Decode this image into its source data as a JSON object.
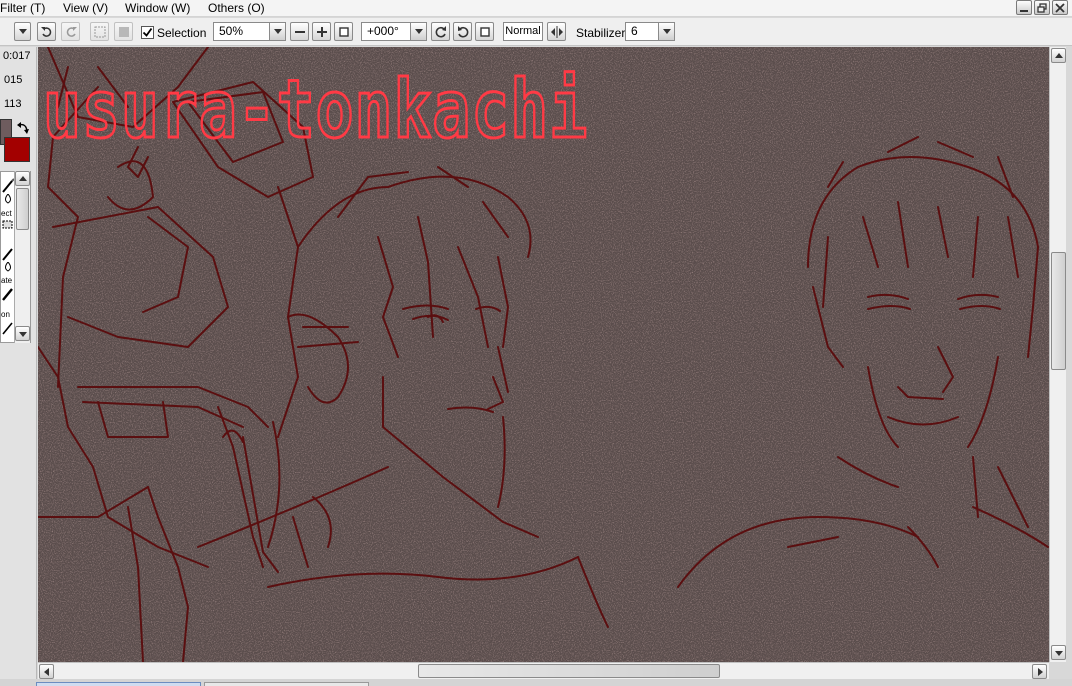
{
  "menubar": {
    "items": [
      "Filter (T)",
      "View (V)",
      "Window (W)",
      "Others (O)"
    ]
  },
  "window_controls": [
    "minimize-icon",
    "restore-icon",
    "close-icon"
  ],
  "toolbar": {
    "selection_label": "Selection",
    "selection_checked": true,
    "zoom_value": "50%",
    "rotation_value": "+000°",
    "mode_label": "Normal",
    "stabilizer_label": "Stabilizer",
    "stabilizer_value": "6"
  },
  "left_panel": {
    "coords": [
      "0:017",
      "015",
      "113"
    ],
    "fg_color": "#6e5c5e",
    "bg_color": "#a30000",
    "tool_labels": [
      "ect",
      "ate",
      "on"
    ]
  },
  "canvas": {
    "background": "#5a4d4c",
    "line_color": "#5b0f10",
    "signature_text": "usura-tonkachi",
    "signature_color": "#ff3a45"
  }
}
